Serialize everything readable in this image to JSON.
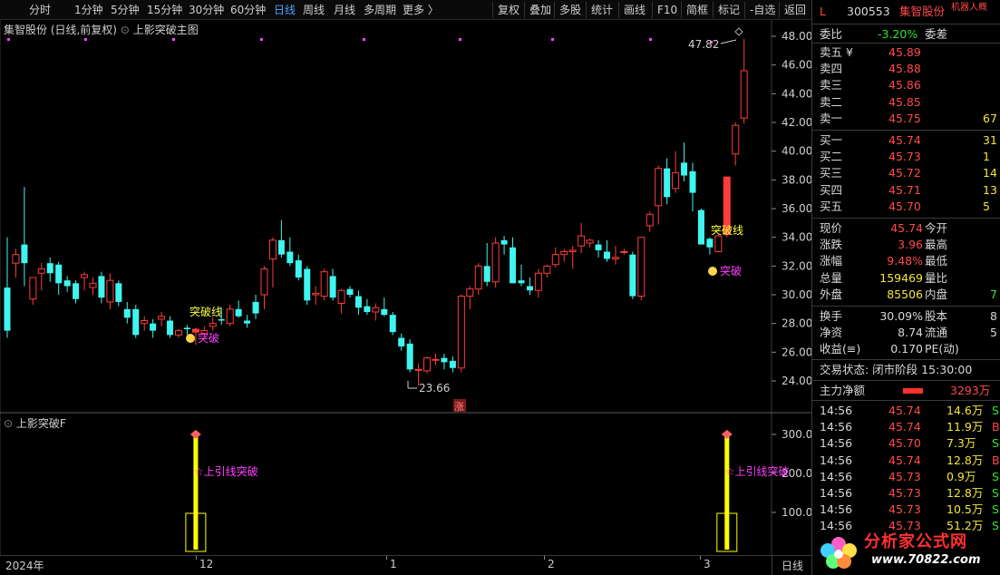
{
  "toolbar": {
    "periods": [
      "分时",
      "1分钟",
      "5分钟",
      "15分钟",
      "30分钟",
      "60分钟",
      "日线",
      "周线",
      "月线",
      "多周期",
      "更多 〉"
    ],
    "active_period": "日线",
    "tools": [
      "复权",
      "叠加",
      "多股",
      "统计",
      "画线",
      "F10",
      "简框",
      "标记",
      "-自选",
      "返回"
    ]
  },
  "main_chart": {
    "title_stock": "集智股份 (日线,前复权)",
    "title_indicator": "上影突破主图",
    "y_ticks": [
      "48.00",
      "46.00",
      "44.00",
      "42.00",
      "40.00",
      "38.00",
      "36.00",
      "34.00",
      "32.00",
      "30.00",
      "28.00",
      "26.00",
      "24.00"
    ],
    "high_label": "47.82",
    "low_label": "23.66",
    "zhang_label": "涨",
    "breakout_line_label": "突破线",
    "breakout_label": "突破"
  },
  "sub_chart": {
    "title": "上影突破F",
    "y_ticks": [
      "300.0",
      "200.0",
      "100.0"
    ],
    "signal_label": "上引线突破"
  },
  "x_axis": {
    "labels": [
      "2024年",
      "12",
      "1",
      "2",
      "3"
    ],
    "period_button": "日线"
  },
  "chart_data": {
    "type": "candlestick",
    "title": "集智股份 (日线,前复权)",
    "ylim": [
      23,
      49
    ],
    "categories_months": [
      "2024年",
      "12",
      "1",
      "2",
      "3"
    ],
    "candles": [
      [
        30.5,
        34.0,
        27.0,
        27.5
      ],
      [
        32.2,
        33.2,
        31.2,
        32.8
      ],
      [
        33.5,
        37.5,
        30.6,
        32.2
      ],
      [
        29.7,
        31.0,
        29.3,
        31.2
      ],
      [
        31.5,
        32.2,
        30.3,
        31.8
      ],
      [
        32.2,
        32.6,
        30.9,
        31.5
      ],
      [
        32.1,
        32.3,
        30.0,
        30.8
      ],
      [
        31.0,
        31.3,
        30.2,
        30.6
      ],
      [
        30.8,
        31.0,
        29.4,
        29.7
      ],
      [
        31.2,
        31.6,
        30.3,
        31.4
      ],
      [
        30.5,
        31.2,
        30.0,
        30.8
      ],
      [
        31.3,
        31.6,
        29.4,
        29.8
      ],
      [
        29.5,
        31.5,
        29.0,
        31.0
      ],
      [
        30.8,
        31.0,
        29.2,
        29.5
      ],
      [
        29.0,
        29.5,
        28.0,
        28.4
      ],
      [
        29.0,
        29.3,
        27.0,
        27.2
      ],
      [
        28.0,
        28.5,
        27.5,
        28.2
      ],
      [
        28.0,
        28.3,
        27.0,
        27.5
      ],
      [
        28.3,
        28.8,
        27.8,
        28.5
      ],
      [
        28.2,
        28.5,
        27.0,
        27.2
      ],
      [
        27.2,
        27.6,
        27.0,
        27.5
      ],
      [
        27.7,
        27.9,
        27.2,
        27.6
      ],
      [
        27.4,
        27.7,
        26.5,
        27.6
      ],
      [
        27.3,
        27.8,
        27.0,
        27.5
      ],
      [
        27.8,
        28.4,
        27.5,
        28.0
      ],
      [
        28.3,
        29.1,
        27.9,
        28.2
      ],
      [
        28.0,
        29.3,
        27.8,
        29.0
      ],
      [
        29.0,
        29.6,
        28.4,
        28.5
      ],
      [
        28.2,
        28.6,
        27.7,
        28.0
      ],
      [
        29.5,
        30.0,
        28.3,
        28.7
      ],
      [
        30.0,
        32.0,
        29.0,
        31.8
      ],
      [
        32.5,
        34.0,
        30.5,
        33.8
      ],
      [
        33.8,
        35.2,
        32.6,
        32.8
      ],
      [
        33.0,
        34.0,
        32.0,
        32.2
      ],
      [
        32.4,
        32.8,
        31.0,
        31.2
      ],
      [
        31.8,
        32.0,
        29.3,
        29.6
      ],
      [
        30.0,
        30.6,
        29.3,
        30.1
      ],
      [
        29.9,
        31.8,
        29.6,
        31.6
      ],
      [
        31.3,
        31.8,
        29.6,
        29.8
      ],
      [
        29.4,
        30.4,
        28.7,
        30.3
      ],
      [
        30.4,
        30.6,
        29.8,
        30.0
      ],
      [
        29.9,
        30.3,
        28.6,
        29.1
      ],
      [
        29.2,
        29.7,
        28.6,
        28.8
      ],
      [
        28.8,
        29.4,
        28.2,
        29.1
      ],
      [
        29.0,
        29.8,
        28.5,
        28.6
      ],
      [
        28.6,
        28.8,
        27.2,
        27.4
      ],
      [
        27.0,
        27.3,
        26.1,
        26.4
      ],
      [
        26.6,
        26.9,
        24.6,
        24.8
      ],
      [
        24.8,
        25.2,
        23.66,
        24.8
      ],
      [
        24.7,
        25.7,
        24.5,
        25.6
      ],
      [
        25.5,
        25.9,
        25.1,
        25.5
      ],
      [
        25.6,
        25.9,
        24.8,
        25.3
      ],
      [
        25.4,
        25.7,
        24.6,
        24.9
      ],
      [
        24.9,
        30.0,
        24.6,
        29.9
      ],
      [
        29.9,
        30.6,
        29.0,
        30.4
      ],
      [
        30.4,
        32.2,
        30.0,
        32.0
      ],
      [
        32.0,
        33.6,
        30.6,
        30.9
      ],
      [
        30.9,
        34.0,
        30.5,
        33.6
      ],
      [
        33.8,
        34.1,
        32.8,
        33.5
      ],
      [
        33.3,
        34.0,
        31.8,
        30.8
      ],
      [
        31.0,
        32.1,
        30.6,
        30.8
      ],
      [
        30.6,
        31.2,
        30.0,
        30.3
      ],
      [
        30.3,
        31.8,
        29.8,
        31.5
      ],
      [
        31.5,
        32.1,
        31.2,
        32.0
      ],
      [
        32.1,
        33.3,
        31.9,
        32.8
      ],
      [
        32.8,
        33.2,
        32.3,
        33.0
      ],
      [
        33.0,
        33.4,
        31.8,
        33.1
      ],
      [
        33.4,
        35.0,
        32.9,
        34.1
      ],
      [
        33.6,
        33.9,
        33.3,
        33.8
      ],
      [
        33.5,
        33.8,
        32.6,
        33.1
      ],
      [
        33.0,
        33.8,
        32.3,
        32.5
      ],
      [
        32.5,
        33.4,
        32.1,
        32.6
      ],
      [
        33.0,
        33.2,
        32.8,
        33.0
      ],
      [
        32.8,
        33.0,
        29.7,
        29.9
      ],
      [
        29.9,
        34.0,
        29.6,
        34.0
      ],
      [
        34.8,
        35.8,
        34.4,
        35.6
      ],
      [
        36.2,
        39.0,
        34.9,
        38.8
      ],
      [
        38.8,
        39.5,
        36.3,
        36.8
      ],
      [
        37.4,
        40.0,
        37.1,
        38.5
      ],
      [
        39.2,
        40.6,
        37.9,
        38.3
      ],
      [
        38.6,
        39.2,
        35.8,
        37.1
      ],
      [
        35.9,
        36.0,
        33.7,
        33.5
      ],
      [
        33.9,
        34.0,
        32.8,
        33.3
      ],
      [
        33.0,
        34.2,
        33.0,
        34.1
      ],
      [
        34.2,
        38.2,
        34.0,
        38.2
      ],
      [
        39.8,
        42.0,
        39.0,
        41.8
      ],
      [
        42.3,
        47.82,
        41.9,
        45.6
      ]
    ],
    "sub_signals": [
      {
        "bar": 22,
        "value": 300
      },
      {
        "bar": 84,
        "value": 300
      }
    ],
    "sub_ylim": [
      0,
      350
    ]
  },
  "right_panel": {
    "header": {
      "flag": "L",
      "code": "300553",
      "name": "集智股份",
      "tag": "机器人概"
    },
    "weibi": {
      "label": "委比",
      "value": "-3.20%",
      "label2": "委差"
    },
    "asks": [
      {
        "label": "卖五 ¥",
        "price": "45.89",
        "vol": ""
      },
      {
        "label": "卖四",
        "price": "45.88",
        "vol": ""
      },
      {
        "label": "卖三",
        "price": "45.86",
        "vol": ""
      },
      {
        "label": "卖二",
        "price": "45.85",
        "vol": ""
      },
      {
        "label": "卖一",
        "price": "45.75",
        "vol": "67"
      }
    ],
    "bids": [
      {
        "label": "买一",
        "price": "45.74",
        "vol": "31"
      },
      {
        "label": "买二",
        "price": "45.73",
        "vol": "1"
      },
      {
        "label": "买三",
        "price": "45.72",
        "vol": "14"
      },
      {
        "label": "买四",
        "price": "45.71",
        "vol": "13"
      },
      {
        "label": "买五",
        "price": "45.70",
        "vol": "5"
      }
    ],
    "stats": [
      {
        "l1": "现价",
        "v1": "45.74",
        "l2": "今开",
        "v2": ""
      },
      {
        "l1": "涨跌",
        "v1": "3.96",
        "l2": "最高",
        "v2": ""
      },
      {
        "l1": "涨幅",
        "v1": "9.48%",
        "l2": "最低",
        "v2": ""
      },
      {
        "l1": "总量",
        "v1": "159469",
        "l2": "量比",
        "v2": ""
      },
      {
        "l1": "外盘",
        "v1": "85506",
        "l2": "内盘",
        "v2": "7"
      }
    ],
    "stats2": [
      {
        "l1": "换手",
        "v1": "30.09%",
        "l2": "股本",
        "v2": "8"
      },
      {
        "l1": "净资",
        "v1": "8.74",
        "l2": "流通",
        "v2": "5"
      },
      {
        "l1": "收益(≡)",
        "v1": "0.170",
        "l2": "PE(动)",
        "v2": ""
      }
    ],
    "trade_status": "交易状态: 闭市阶段 15:30:00",
    "main_flow": {
      "label": "主力净额",
      "value": "3293万"
    },
    "ticks": [
      {
        "t": "14:56",
        "p": "45.74",
        "v": "14.6万",
        "d": "S"
      },
      {
        "t": "14:56",
        "p": "45.74",
        "v": "11.9万",
        "d": "B"
      },
      {
        "t": "14:56",
        "p": "45.70",
        "v": "7.3万",
        "d": "S"
      },
      {
        "t": "14:56",
        "p": "45.74",
        "v": "12.8万",
        "d": "B"
      },
      {
        "t": "14:56",
        "p": "45.73",
        "v": "0.9万",
        "d": "S"
      },
      {
        "t": "14:56",
        "p": "45.73",
        "v": "12.8万",
        "d": "S"
      },
      {
        "t": "14:56",
        "p": "45.73",
        "v": "10.5万",
        "d": "S"
      },
      {
        "t": "14:56",
        "p": "45.73",
        "v": "51.2万",
        "d": "S"
      }
    ]
  },
  "watermark": {
    "text": "分析家公式网",
    "url": "www.70822.com"
  },
  "colors": {
    "up": "#ff3b3b",
    "down": "#3ff5f0",
    "signal": "#ffff00",
    "label": "#ff40ff"
  }
}
